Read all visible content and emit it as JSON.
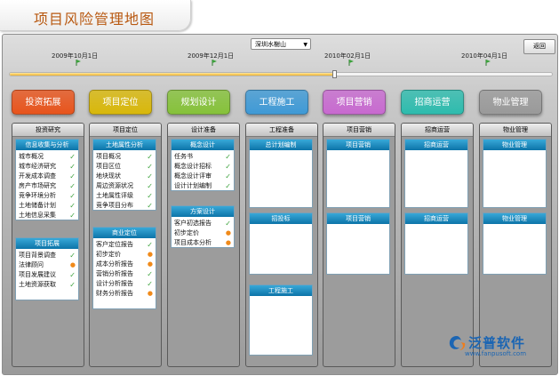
{
  "page": {
    "title": "项目风险管理地图"
  },
  "toolbar": {
    "project_select": "深圳水榭山",
    "back_label": "返回"
  },
  "timeline": {
    "progress": 0.6,
    "dates": [
      "2009年10月1日",
      "2009年12月1日",
      "2010年02月1日",
      "2010年04月1日"
    ]
  },
  "phases": [
    {
      "label": "投资拓展",
      "color": "#e8541c"
    },
    {
      "label": "项目定位",
      "color": "#d9b80a"
    },
    {
      "label": "规划设计",
      "color": "#86c23a"
    },
    {
      "label": "工程施工",
      "color": "#3f9ad6"
    },
    {
      "label": "项目营销",
      "color": "#c86ad0"
    },
    {
      "label": "招商运营",
      "color": "#2ebcae"
    },
    {
      "label": "物业管理",
      "color": "#9a9a9a"
    }
  ],
  "columns": [
    {
      "title": "投资研究",
      "panels": [
        {
          "title": "信息收集与分析",
          "items": [
            {
              "label": "城市概况",
              "status": "done"
            },
            {
              "label": "城市经济研究",
              "status": "done"
            },
            {
              "label": "开发成本调查",
              "status": "done"
            },
            {
              "label": "房产市场研究",
              "status": "done"
            },
            {
              "label": "竞争环境分析",
              "status": "done"
            },
            {
              "label": "土地储备计划",
              "status": "done"
            },
            {
              "label": "土地信息采集",
              "status": "done"
            }
          ]
        },
        {
          "title": "项目拓展",
          "items": [
            {
              "label": "项目背景调查",
              "status": "done"
            },
            {
              "label": "法律顾问",
              "status": "pending"
            },
            {
              "label": "项目发展建议",
              "status": "done"
            },
            {
              "label": "土地资源获取",
              "status": "done"
            }
          ]
        }
      ]
    },
    {
      "title": "项目定位",
      "panels": [
        {
          "title": "土地属性分析",
          "items": [
            {
              "label": "项目概况",
              "status": "done"
            },
            {
              "label": "项目区位",
              "status": "done"
            },
            {
              "label": "地块现状",
              "status": "done"
            },
            {
              "label": "周边资源状况",
              "status": "done"
            },
            {
              "label": "土地属性评级",
              "status": "done"
            },
            {
              "label": "竞争项目分布",
              "status": "done"
            }
          ]
        },
        {
          "title": "商业定位",
          "items": [
            {
              "label": "客户定位报告",
              "status": "done"
            },
            {
              "label": "初步定价",
              "status": "pending"
            },
            {
              "label": "成本分析报告",
              "status": "pending"
            },
            {
              "label": "营销分析报告",
              "status": "done"
            },
            {
              "label": "设计分析报告",
              "status": "done"
            },
            {
              "label": "财务分析报告",
              "status": "pending"
            }
          ]
        }
      ]
    },
    {
      "title": "设计准备",
      "panels": [
        {
          "title": "概念设计",
          "items": [
            {
              "label": "任务书",
              "status": "done"
            },
            {
              "label": "概念设计招标",
              "status": "done"
            },
            {
              "label": "概念设计评审",
              "status": "done"
            },
            {
              "label": "设计计划编制",
              "status": "done"
            }
          ]
        },
        {
          "title": "方案设计",
          "items": [
            {
              "label": "客户初选报告",
              "status": "done"
            },
            {
              "label": "初步定价",
              "status": "pending"
            },
            {
              "label": "项目成本分析",
              "status": "pending"
            }
          ]
        }
      ]
    },
    {
      "title": "工程准备",
      "panels": [
        {
          "title": "总计划编制",
          "items": []
        },
        {
          "title": "招投标",
          "items": []
        },
        {
          "title": "工程施工",
          "items": []
        }
      ]
    },
    {
      "title": "项目营销",
      "panels": [
        {
          "title": "项目营销",
          "items": []
        },
        {
          "title": "项目营销",
          "items": []
        }
      ]
    },
    {
      "title": "招商运营",
      "panels": [
        {
          "title": "招商运营",
          "items": []
        },
        {
          "title": "招商运营",
          "items": []
        }
      ]
    },
    {
      "title": "物业管理",
      "panels": [
        {
          "title": "物业管理",
          "items": []
        },
        {
          "title": "物业管理",
          "items": []
        }
      ]
    }
  ],
  "branding": {
    "name": "泛普软件",
    "url": "www.fanpusoft.com"
  },
  "colors": {
    "done": "#3ca23c",
    "pending": "#f08a1a",
    "panel_header": "#1a8cc4"
  },
  "icons": {
    "date_marker": "flag-icon",
    "done": "check-icon",
    "pending": "circle-icon",
    "logo": "swirl-logo-icon"
  }
}
